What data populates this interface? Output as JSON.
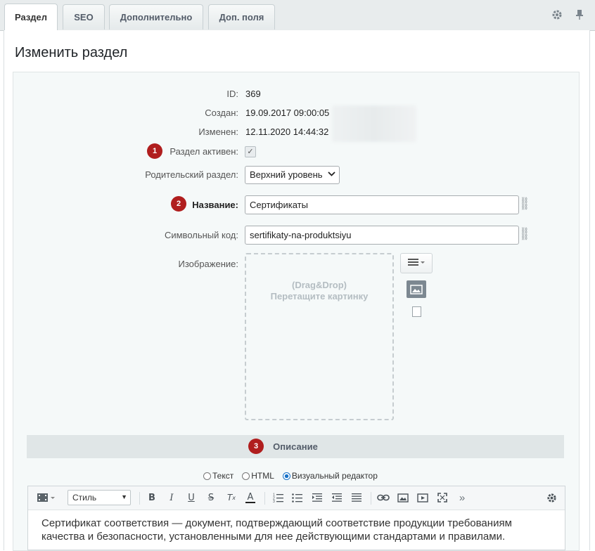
{
  "tabs": [
    {
      "label": "Раздел",
      "active": true
    },
    {
      "label": "SEO",
      "active": false
    },
    {
      "label": "Дополнительно",
      "active": false
    },
    {
      "label": "Доп. поля",
      "active": false
    }
  ],
  "toolbar_icons": [
    "gear-icon",
    "pin-icon"
  ],
  "page_title": "Изменить раздел",
  "fields": {
    "id_label": "ID:",
    "id_value": "369",
    "created_label": "Создан:",
    "created_value": "19.09.2017 09:00:05",
    "modified_label": "Изменен:",
    "modified_value": "12.11.2020 14:44:32",
    "active_label": "Раздел активен:",
    "active_checked": true,
    "parent_label": "Родительский раздел:",
    "parent_value": "Верхний уровень",
    "name_label": "Название:",
    "name_value": "Сертификаты",
    "code_label": "Символьный код:",
    "code_value": "sertifikaty-na-produktsiyu",
    "image_label": "Изображение:"
  },
  "dropzone": {
    "line1": "(Drag&Drop)",
    "line2": "Перетащите картинку"
  },
  "badges": [
    "1",
    "2",
    "3"
  ],
  "description_section": "Описание",
  "editor_modes": [
    {
      "label": "Текст",
      "selected": false
    },
    {
      "label": "HTML",
      "selected": false
    },
    {
      "label": "Визуальный редактор",
      "selected": true
    }
  ],
  "editor": {
    "style_label": "Стиль",
    "content": "Сертификат соответствия — документ, подтверждающий соответствие продукции требованиям качества и безопасности, установленными для нее действующими стандартами и правилами."
  },
  "colors": {
    "badge": "#b01e1e",
    "radio_selected": "#1a73c8",
    "section_bg": "#e0e6e7"
  }
}
